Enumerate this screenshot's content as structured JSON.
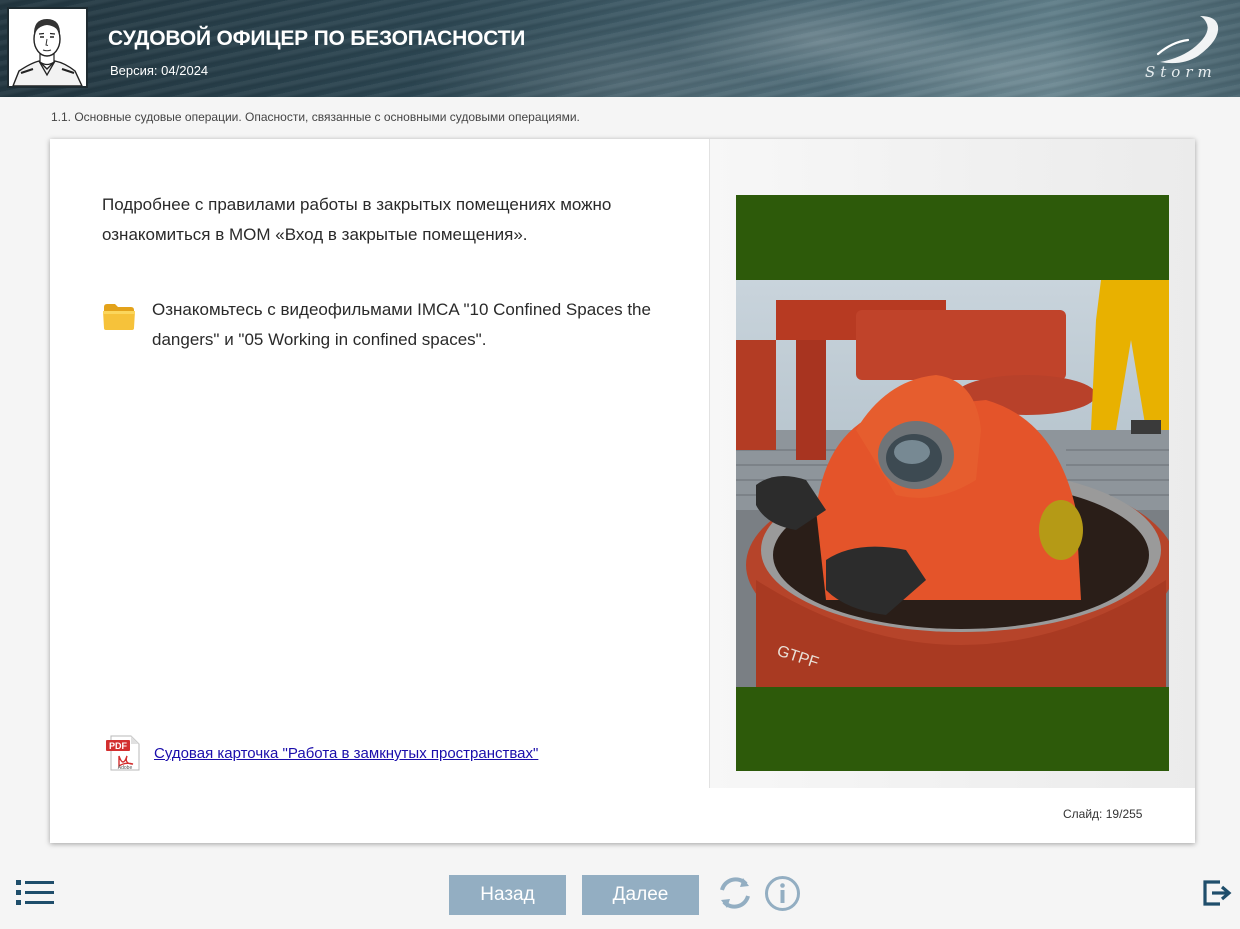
{
  "header": {
    "title": "СУДОВОЙ ОФИЦЕР ПО БЕЗОПАСНОСТИ",
    "version": "Версия: 04/2024",
    "logo_text": "Storm"
  },
  "breadcrumb": "1.1. Основные судовые операции. Опасности, связанные с основными судовыми операциями.",
  "slide": {
    "paragraph": "Подробнее с правилами работы в закрытых помещениях можно ознакомиться в МОМ «Вход в закрытые помещения».",
    "folder_text": "Ознакомьтесь с видеофильмами IMCA \"10 Confined Spaces the dangers\" и \"05 Working in confined spaces\".",
    "pdf_link": "Судовая карточка \"Работа в замкнутых пространствах\"",
    "counter_label": "Слайд:",
    "counter_current": "19",
    "counter_total": "255"
  },
  "footer": {
    "back_label": "Назад",
    "next_label": "Далее"
  },
  "colors": {
    "accent_button": "#93aec2",
    "icon_color": "#1f4e6b",
    "photo_frame": "#2d5a0a"
  }
}
